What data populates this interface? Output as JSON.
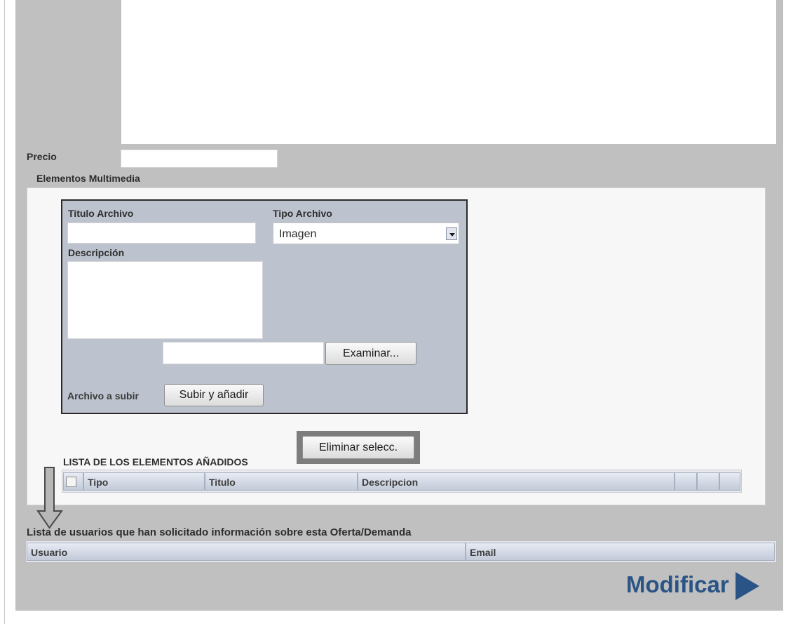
{
  "precio": {
    "label": "Precio",
    "value": ""
  },
  "multimedia": {
    "legend": "Elementos Multimedia",
    "titulo_label": "Titulo Archivo",
    "titulo_value": "",
    "tipo_label": "Tipo Archivo",
    "tipo_selected": "Imagen",
    "descripcion_label": "Descripción",
    "browse_button": "Examinar...",
    "archivo_label": "Archivo a subir",
    "upload_button": "Subir y añadir",
    "delete_button": "Eliminar selecc.",
    "list_title": "LISTA DE LOS ELEMENTOS AÑADIDOS",
    "columns": [
      "Tipo",
      "Titulo",
      "Descripcion"
    ]
  },
  "usuarios": {
    "title": "Lista de usuarios que han solicitado información sobre esta Oferta/Demanda",
    "columns": [
      "Usuario",
      "Email"
    ]
  },
  "submit_label": "Modificar",
  "colors": {
    "panel": "#c0c0c0",
    "form_box": "#bcc3ce",
    "accent": "#2b5486"
  },
  "icons": [
    "chevron-down-icon",
    "down-arrow-icon",
    "play-arrow-icon"
  ]
}
